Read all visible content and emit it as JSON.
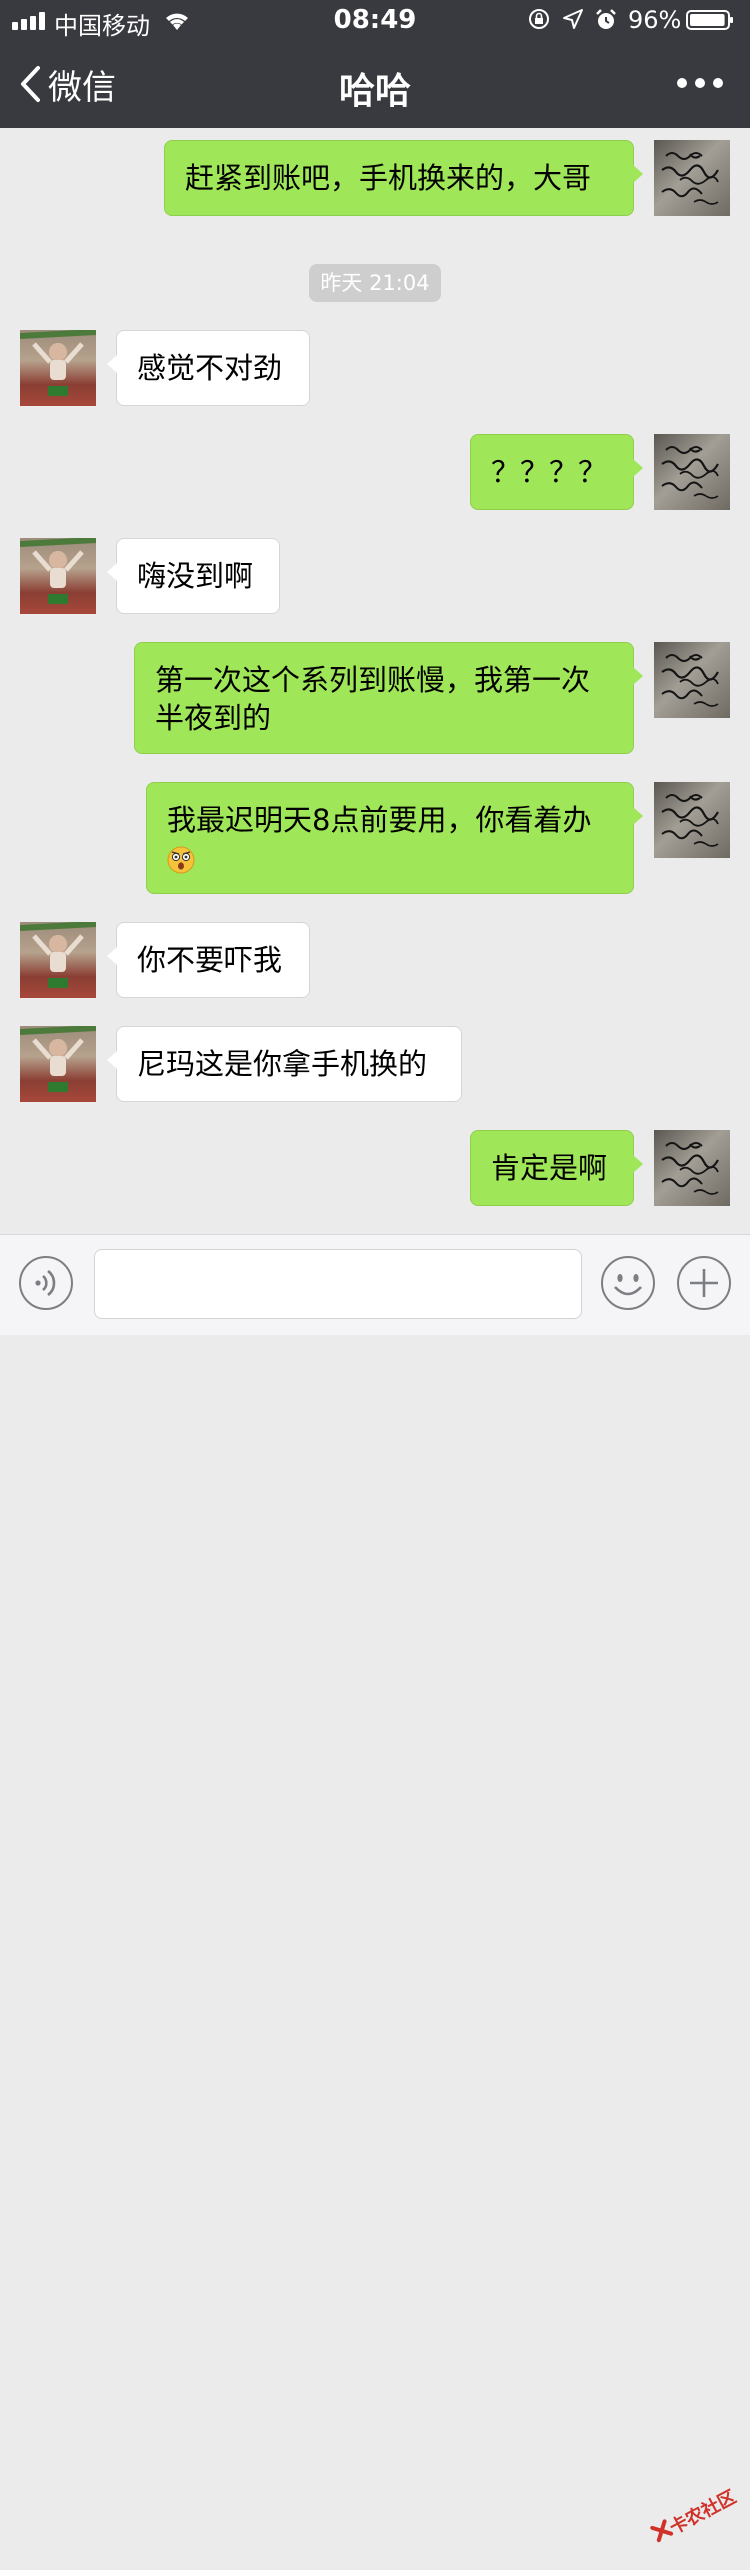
{
  "status_bar": {
    "carrier": "中国移动",
    "time": "08:49",
    "battery_percent": "96%",
    "battery_level": 0.96,
    "icons": [
      "signal-icon",
      "wifi-icon",
      "orientation-lock-icon",
      "location-icon",
      "alarm-icon",
      "battery-icon"
    ]
  },
  "nav": {
    "back_label": "微信",
    "title": "哈哈",
    "more_icon": "more-icon"
  },
  "chat": {
    "timestamp": "昨天 21:04",
    "messages": [
      {
        "from": "me",
        "text": "赶紧到账吧，手机换来的，大哥"
      },
      {
        "from": "other",
        "text": "感觉不对劲"
      },
      {
        "from": "me",
        "text": "？？？？"
      },
      {
        "from": "other",
        "text": "嗨没到啊"
      },
      {
        "from": "me",
        "line1": "第一次这个系列到账慢，我第一次",
        "line2": "半夜到的"
      },
      {
        "from": "me",
        "text": "我最迟明天8点前要用，你看着办",
        "emoji": "astonished-emoji"
      },
      {
        "from": "other",
        "text": "你不要吓我"
      },
      {
        "from": "other",
        "text": "尼玛这是你拿手机换的"
      },
      {
        "from": "me",
        "text": "肯定是啊"
      }
    ]
  },
  "input_bar": {
    "voice_icon": "voice-icon",
    "emoji_icon": "emoji-icon",
    "plus_icon": "plus-icon",
    "text_value": ""
  },
  "watermark": {
    "text": "卡农社区"
  },
  "colors": {
    "nav_bg": "#393a3f",
    "chat_bg": "#ebebeb",
    "my_bubble": "#9fe658",
    "other_bubble": "#ffffff",
    "timestamp_bg": "#cecece"
  }
}
